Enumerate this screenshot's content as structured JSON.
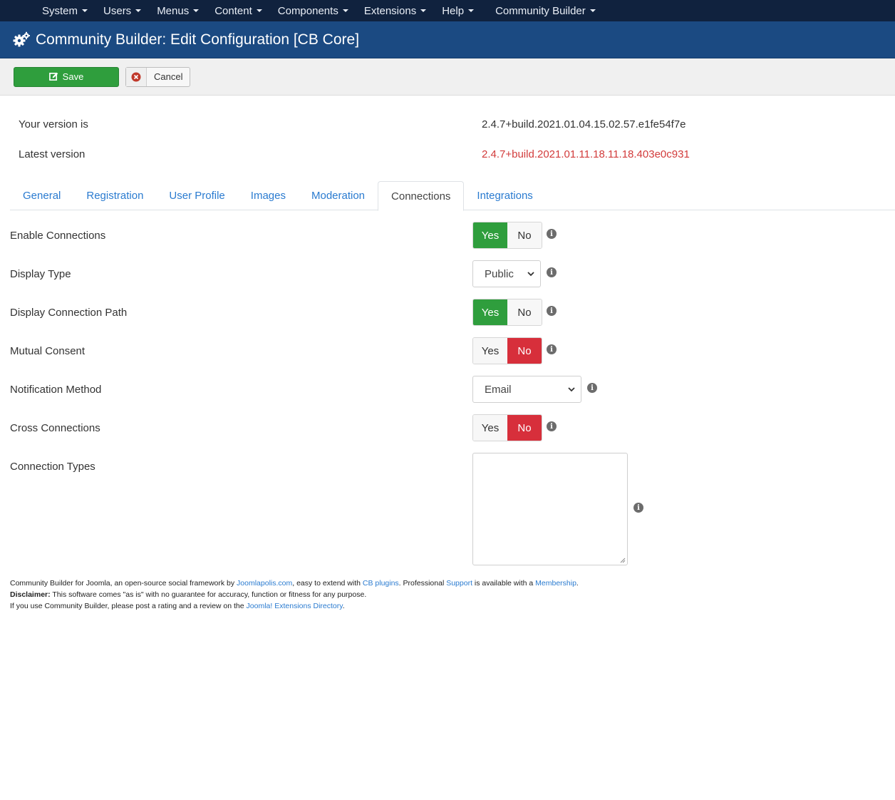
{
  "topnav": {
    "items": [
      "System",
      "Users",
      "Menus",
      "Content",
      "Components",
      "Extensions",
      "Help"
    ],
    "extra": "Community Builder"
  },
  "header": {
    "title": "Community Builder: Edit Configuration [CB Core]"
  },
  "toolbar": {
    "save_label": "Save",
    "cancel_label": "Cancel"
  },
  "version": {
    "current_label": "Your version is",
    "current_value": "2.4.7+build.2021.01.04.15.02.57.e1fe54f7e",
    "latest_label": "Latest version",
    "latest_value": "2.4.7+build.2021.01.11.18.11.18.403e0c931",
    "latest_color": "#d23b3b"
  },
  "tabs": [
    "General",
    "Registration",
    "User Profile",
    "Images",
    "Moderation",
    "Connections",
    "Integrations"
  ],
  "active_tab": "Connections",
  "fields": {
    "enable_connections": {
      "label": "Enable Connections",
      "yes": "Yes",
      "no": "No",
      "value": "Yes"
    },
    "display_type": {
      "label": "Display Type",
      "value": "Public"
    },
    "display_connection_path": {
      "label": "Display Connection Path",
      "yes": "Yes",
      "no": "No",
      "value": "Yes"
    },
    "mutual_consent": {
      "label": "Mutual Consent",
      "yes": "Yes",
      "no": "No",
      "value": "No"
    },
    "notification_method": {
      "label": "Notification Method",
      "value": "Email"
    },
    "cross_connections": {
      "label": "Cross Connections",
      "yes": "Yes",
      "no": "No",
      "value": "No"
    },
    "connection_types": {
      "label": "Connection Types",
      "value": ""
    }
  },
  "footer": {
    "line1_a": "Community Builder for Joomla, an open-source social framework by ",
    "link_joomlapolis": "Joomlapolis.com",
    "line1_b": ", easy to extend with ",
    "link_cb_plugins": "CB plugins",
    "line1_c": ". Professional ",
    "link_support": "Support",
    "line1_d": " is available with a ",
    "link_membership": "Membership",
    "line1_e": ".",
    "disclaimer_label": "Disclaimer:",
    "disclaimer_text": " This software comes \"as is\" with no guarantee for accuracy, function or fitness for any purpose.",
    "line3_a": "If you use Community Builder, please post a rating and a review on the ",
    "link_jed": "Joomla! Extensions Directory",
    "line3_b": "."
  },
  "colors": {
    "topnav_bg": "#10223e",
    "titlebar_bg": "#1b4a82",
    "yes_active": "#2f9e3d",
    "no_active": "#d72f3b",
    "link": "#2a7bd0"
  }
}
